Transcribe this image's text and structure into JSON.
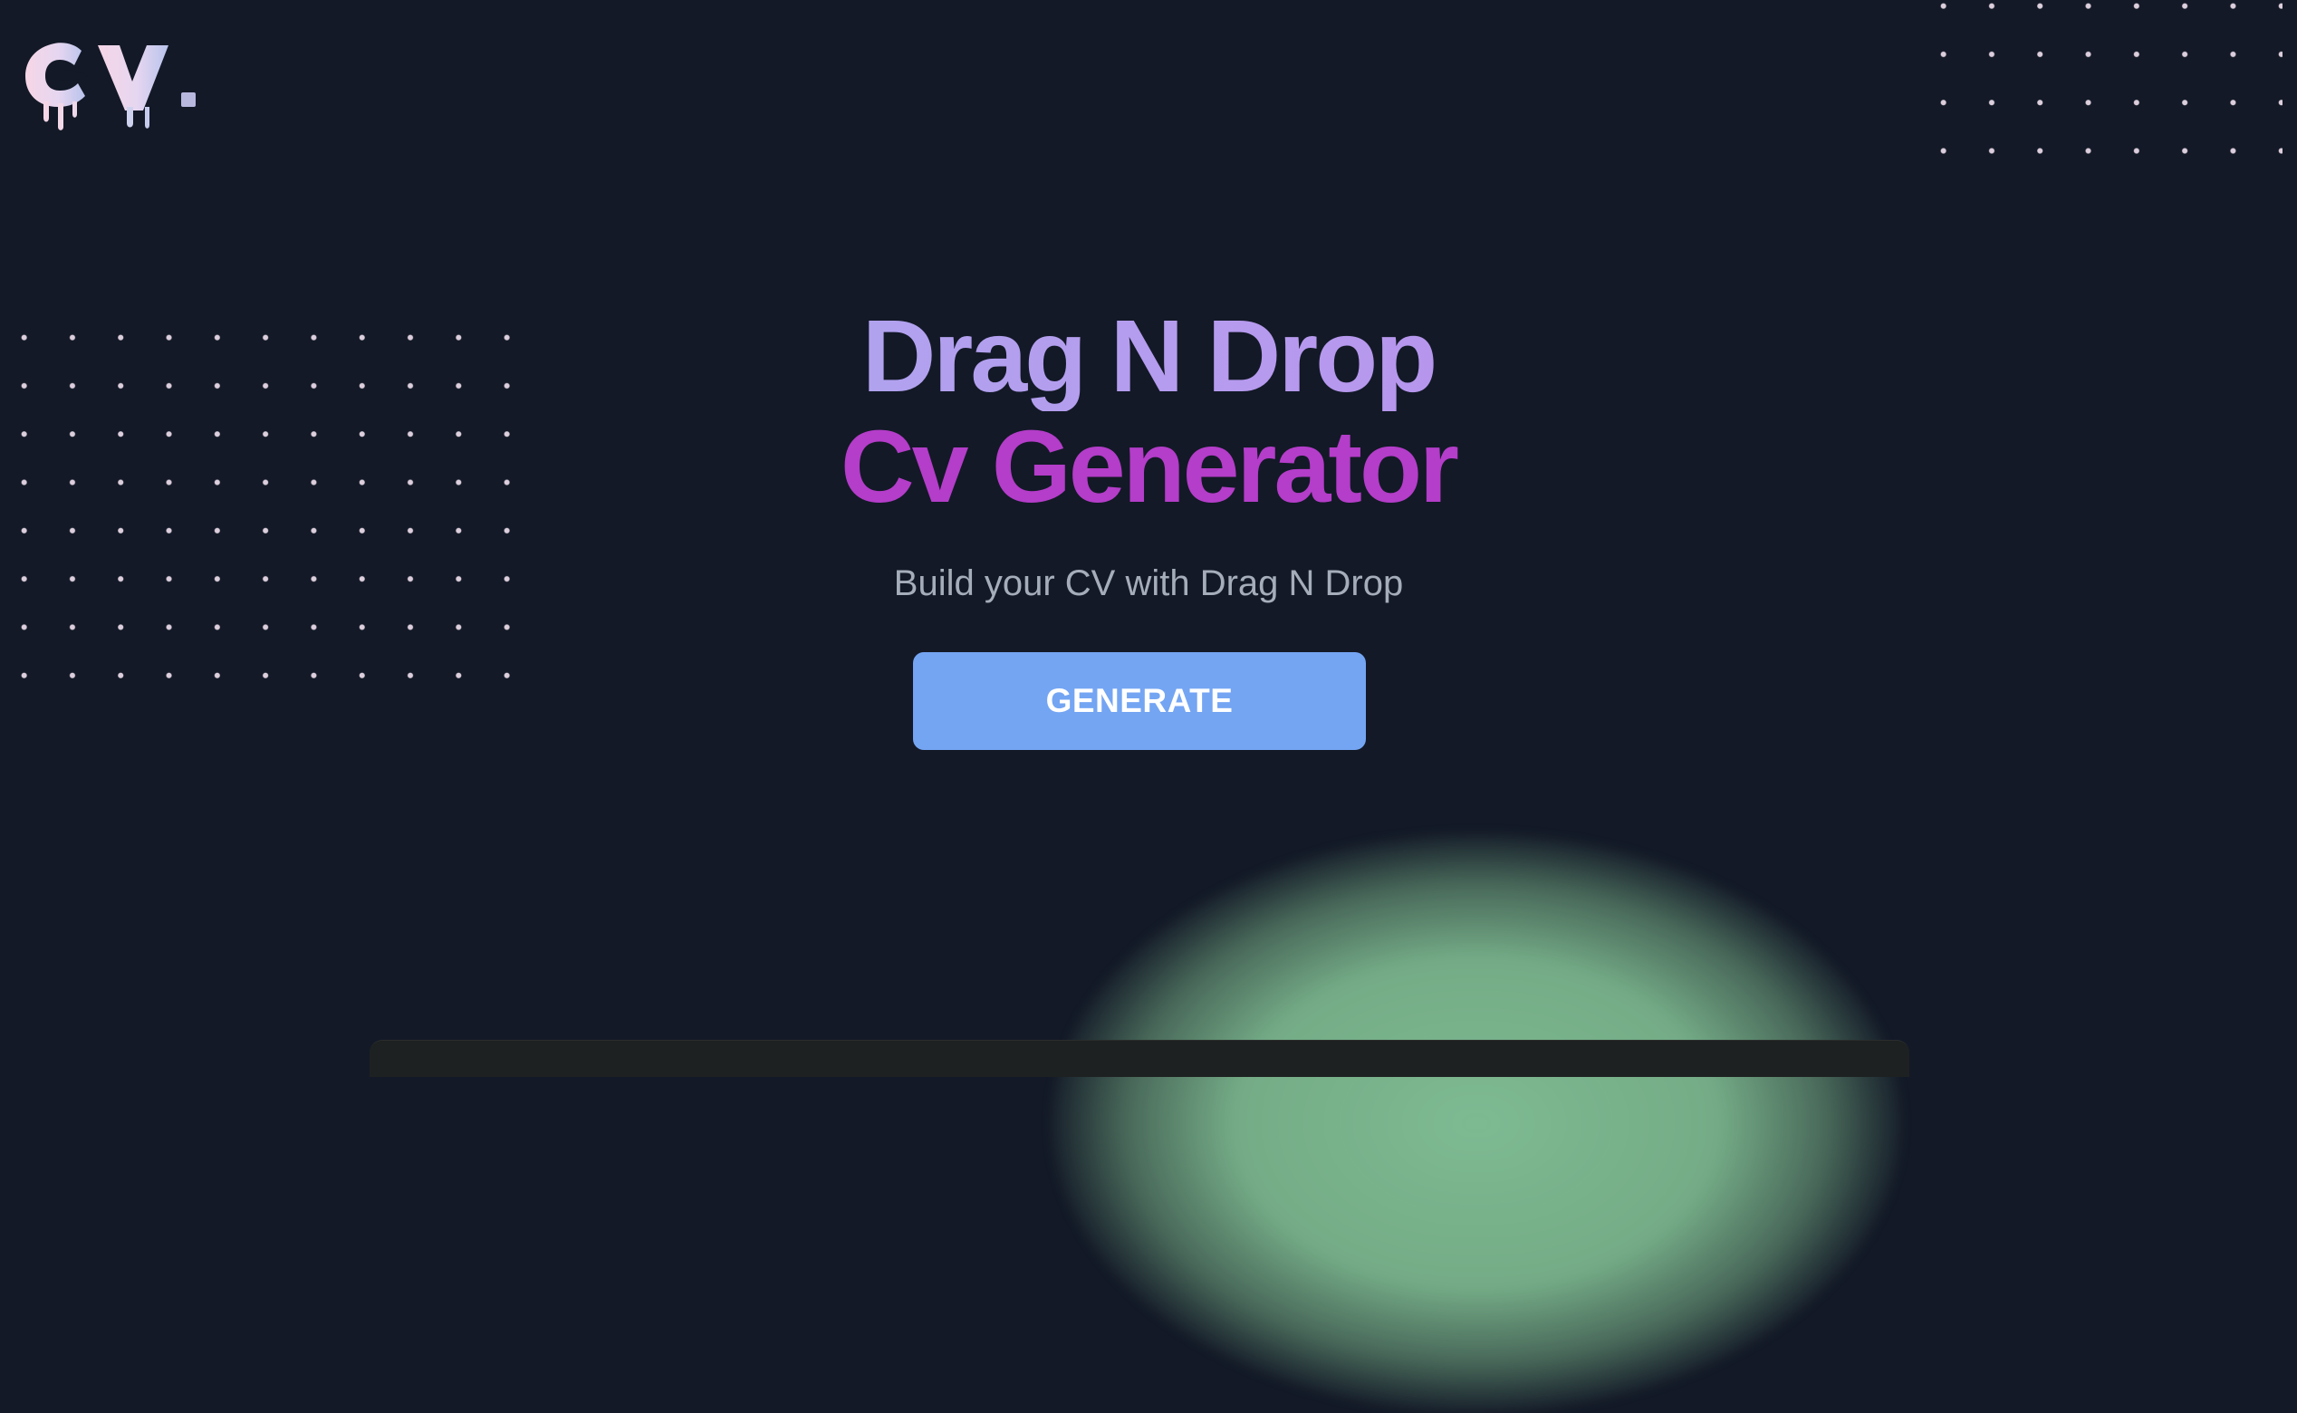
{
  "logo": {
    "text": "CV.",
    "icon": "dripping-cv-logo"
  },
  "hero": {
    "title_line_1": "Drag N Drop",
    "title_line_2": "Cv Generator",
    "subtitle": "Build your CV with Drag N Drop"
  },
  "actions": {
    "generate_label": "GENERATE"
  },
  "colors": {
    "background": "#131927",
    "title_gradient_start": "#a5b3f0",
    "title_gradient_end": "#b884e6",
    "title_accent": "#b43dc9",
    "subtitle": "#a6adba",
    "button_background": "#74a5f3",
    "button_text": "#ffffff",
    "glow": "#7ab48c",
    "dots": "#eedeec"
  }
}
